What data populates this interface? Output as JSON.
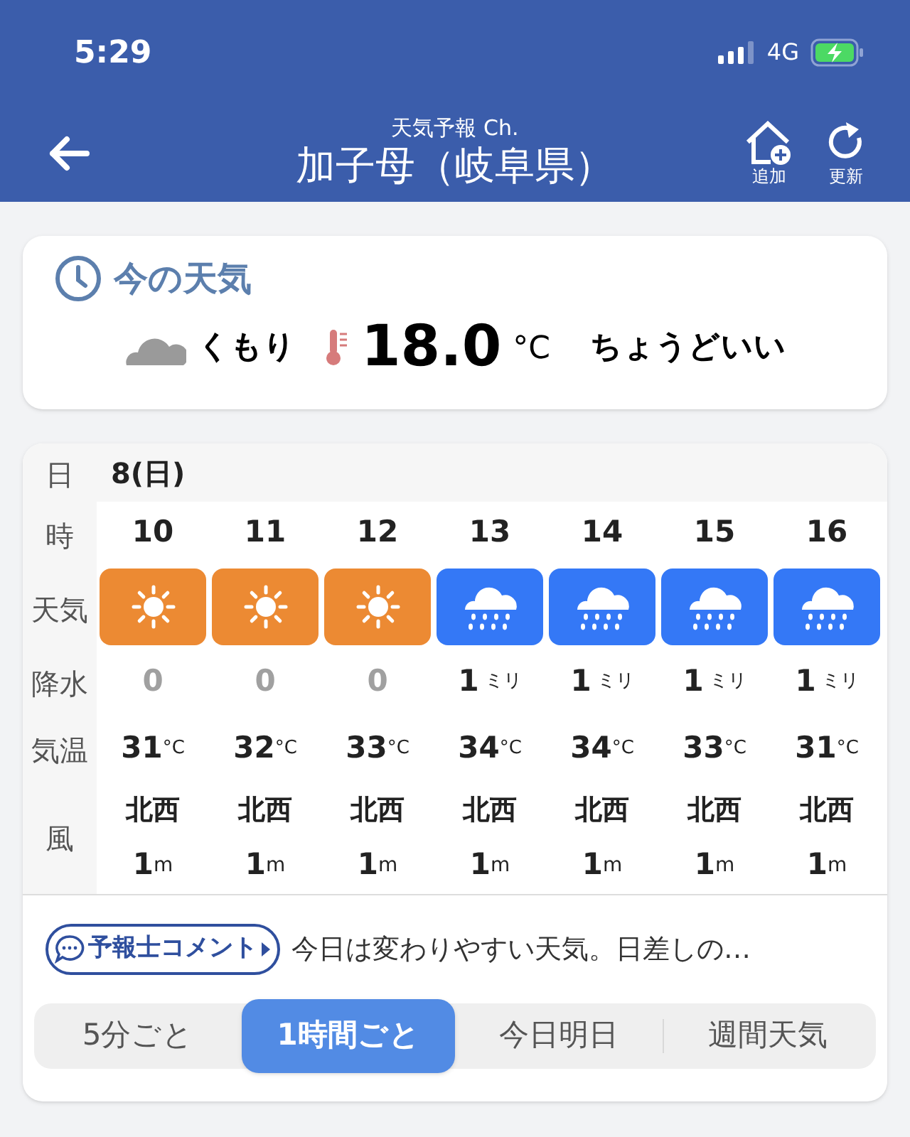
{
  "status_bar": {
    "time": "5:29",
    "network": "4G"
  },
  "header": {
    "subtitle": "天気予報 Ch.",
    "title": "加子母（岐阜県）",
    "actions": [
      {
        "kind": "add",
        "label": "追加"
      },
      {
        "kind": "refresh",
        "label": "更新"
      }
    ]
  },
  "current": {
    "heading": "今の天気",
    "condition": "くもり",
    "temperature": "18.0",
    "unit": "°C",
    "feel": "ちょうどいい"
  },
  "forecast": {
    "row_labels": [
      "日",
      "時",
      "天気",
      "降水",
      "気温",
      "風"
    ],
    "date": "8(日)",
    "hours": [
      {
        "hour": "10",
        "kind": "sunny",
        "precip": "0",
        "dry": true,
        "temp": "31",
        "temp_unit": "°C",
        "wind_dir": "北西",
        "wind_speed": "1",
        "wind_unit": "m"
      },
      {
        "hour": "11",
        "kind": "sunny",
        "precip": "0",
        "dry": true,
        "temp": "32",
        "temp_unit": "°C",
        "wind_dir": "北西",
        "wind_speed": "1",
        "wind_unit": "m"
      },
      {
        "hour": "12",
        "kind": "sunny",
        "precip": "0",
        "dry": true,
        "temp": "33",
        "temp_unit": "°C",
        "wind_dir": "北西",
        "wind_speed": "1",
        "wind_unit": "m"
      },
      {
        "hour": "13",
        "kind": "rain",
        "precip": "1",
        "precip_unit": "ミリ",
        "dry": false,
        "temp": "34",
        "temp_unit": "°C",
        "wind_dir": "北西",
        "wind_speed": "1",
        "wind_unit": "m"
      },
      {
        "hour": "14",
        "kind": "rain",
        "precip": "1",
        "precip_unit": "ミリ",
        "dry": false,
        "temp": "34",
        "temp_unit": "°C",
        "wind_dir": "北西",
        "wind_speed": "1",
        "wind_unit": "m"
      },
      {
        "hour": "15",
        "kind": "rain",
        "precip": "1",
        "precip_unit": "ミリ",
        "dry": false,
        "temp": "33",
        "temp_unit": "°C",
        "wind_dir": "北西",
        "wind_speed": "1",
        "wind_unit": "m"
      },
      {
        "hour": "16",
        "kind": "rain",
        "precip": "1",
        "precip_unit": "ミリ",
        "dry": false,
        "temp": "31",
        "temp_unit": "°C",
        "wind_dir": "北西",
        "wind_speed": "1",
        "wind_unit": "m"
      }
    ],
    "comment_button": "予報士コメント",
    "comment": "今日は変わりやすい天気。日差しの…",
    "tabs": [
      {
        "label": "5分ごと",
        "selected": false
      },
      {
        "label": "1時間ごと",
        "selected": true
      },
      {
        "label": "今日明日",
        "selected": false
      },
      {
        "label": "週間天気",
        "selected": false
      }
    ]
  }
}
